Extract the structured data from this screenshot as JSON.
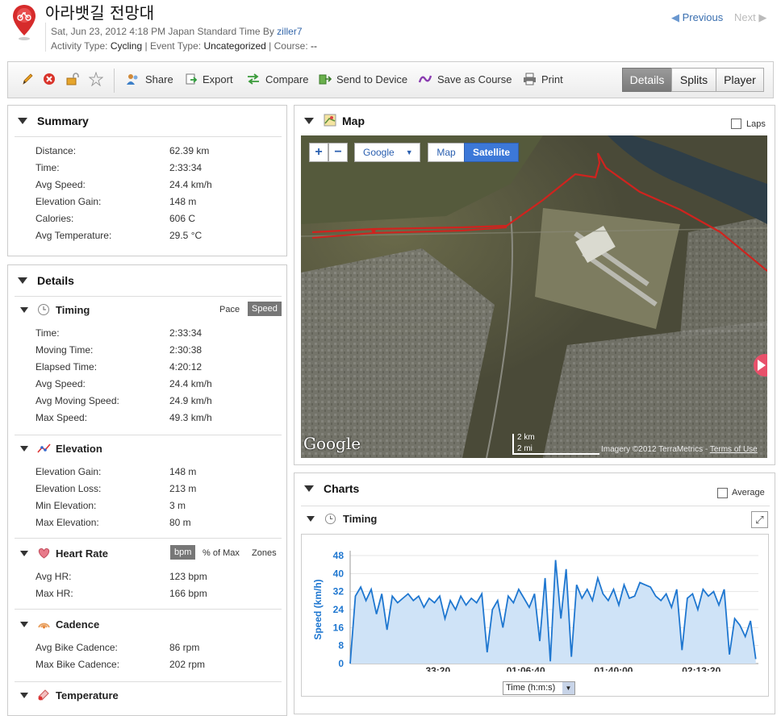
{
  "header": {
    "title": "아라뱃길 전망대",
    "date": "Sat, Jun 23, 2012 4:18 PM Japan Standard Time By ",
    "author": "ziller7",
    "activity_label": "Activity Type: ",
    "activity_value": "Cycling",
    "event_label": " | Event Type: ",
    "event_value": "Uncategorized",
    "course_label": " | Course: ",
    "course_value": "--",
    "prev": "Previous",
    "next": "Next"
  },
  "toolbar": {
    "share": "Share",
    "export": "Export",
    "compare": "Compare",
    "send": "Send to Device",
    "course": "Save as Course",
    "print": "Print",
    "tabs": [
      "Details",
      "Splits",
      "Player"
    ],
    "active_tab": "Details"
  },
  "summary": {
    "title": "Summary",
    "rows": [
      {
        "label": "Distance:",
        "value": "62.39 km"
      },
      {
        "label": "Time:",
        "value": "2:33:34"
      },
      {
        "label": "Avg Speed:",
        "value": "24.4 km/h"
      },
      {
        "label": "Elevation Gain:",
        "value": "148 m"
      },
      {
        "label": "Calories:",
        "value": "606 C"
      },
      {
        "label": "Avg Temperature:",
        "value": "29.5 °C"
      }
    ]
  },
  "details": {
    "title": "Details",
    "timing": {
      "title": "Timing",
      "pace": "Pace",
      "speed": "Speed",
      "rows": [
        {
          "label": "Time:",
          "value": "2:33:34"
        },
        {
          "label": "Moving Time:",
          "value": "2:30:38"
        },
        {
          "label": "Elapsed Time:",
          "value": "4:20:12"
        },
        {
          "label": "Avg Speed:",
          "value": "24.4 km/h"
        },
        {
          "label": "Avg Moving Speed:",
          "value": "24.9 km/h"
        },
        {
          "label": "Max Speed:",
          "value": "49.3 km/h"
        }
      ]
    },
    "elevation": {
      "title": "Elevation",
      "rows": [
        {
          "label": "Elevation Gain:",
          "value": "148 m"
        },
        {
          "label": "Elevation Loss:",
          "value": "213 m"
        },
        {
          "label": "Min Elevation:",
          "value": "3 m"
        },
        {
          "label": "Max Elevation:",
          "value": "80 m"
        }
      ]
    },
    "heart": {
      "title": "Heart Rate",
      "bpm": "bpm",
      "pct": "% of Max",
      "zones": "Zones",
      "rows": [
        {
          "label": "Avg HR:",
          "value": "123 bpm"
        },
        {
          "label": "Max HR:",
          "value": "166 bpm"
        }
      ]
    },
    "cadence": {
      "title": "Cadence",
      "rows": [
        {
          "label": "Avg Bike Cadence:",
          "value": "86 rpm"
        },
        {
          "label": "Max Bike Cadence:",
          "value": "202 rpm"
        }
      ]
    },
    "temperature": {
      "title": "Temperature"
    }
  },
  "map": {
    "title": "Map",
    "laps": "Laps",
    "zoom_in": "+",
    "zoom_out": "−",
    "provider": "Google",
    "map_btn": "Map",
    "sat_btn": "Satellite",
    "logo": "Google",
    "scale_km": "2 km",
    "scale_mi": "2 mi",
    "credit": "Imagery ©2012 TerraMetrics - ",
    "terms": "Terms of Use"
  },
  "charts": {
    "title": "Charts",
    "average": "Average",
    "timing_title": "Timing",
    "xselect": "Time (h:m:s)"
  },
  "chart_data": {
    "type": "area",
    "title": "Timing",
    "ylabel": "Speed (km/h)",
    "xlabel": "Time (h:m:s)",
    "ylim": [
      0,
      48
    ],
    "yticks": [
      0,
      8,
      16,
      24,
      32,
      40,
      48
    ],
    "xticks": [
      "33:20",
      "01:06:40",
      "01:40:00",
      "02:13:20"
    ],
    "xtick_seconds": [
      2000,
      4000,
      6000,
      8000
    ],
    "xlim": [
      0,
      9300
    ],
    "color": "#1f77d0",
    "x": [
      0,
      120,
      240,
      360,
      480,
      600,
      720,
      840,
      960,
      1080,
      1200,
      1320,
      1440,
      1560,
      1680,
      1800,
      1920,
      2040,
      2160,
      2280,
      2400,
      2520,
      2640,
      2760,
      2880,
      3000,
      3120,
      3240,
      3360,
      3480,
      3600,
      3720,
      3840,
      3960,
      4080,
      4200,
      4320,
      4440,
      4560,
      4680,
      4800,
      4920,
      5040,
      5160,
      5280,
      5400,
      5520,
      5640,
      5760,
      5880,
      6000,
      6120,
      6240,
      6360,
      6480,
      6600,
      6720,
      6840,
      6960,
      7080,
      7200,
      7320,
      7440,
      7560,
      7680,
      7800,
      7920,
      8040,
      8160,
      8280,
      8400,
      8520,
      8640,
      8760,
      8880,
      9000,
      9120,
      9240
    ],
    "y": [
      0,
      30,
      34,
      28,
      33,
      22,
      31,
      15,
      30,
      27,
      29,
      31,
      28,
      30,
      25,
      29,
      27,
      30,
      20,
      28,
      24,
      30,
      26,
      29,
      27,
      31,
      5,
      24,
      28,
      16,
      30,
      27,
      33,
      29,
      25,
      31,
      10,
      38,
      1,
      46,
      20,
      42,
      3,
      35,
      29,
      33,
      28,
      38,
      31,
      28,
      33,
      26,
      35,
      29,
      30,
      36,
      35,
      34,
      30,
      28,
      31,
      25,
      33,
      6,
      29,
      31,
      24,
      33,
      30,
      32,
      26,
      33,
      4,
      20,
      17,
      12,
      19,
      2
    ]
  }
}
